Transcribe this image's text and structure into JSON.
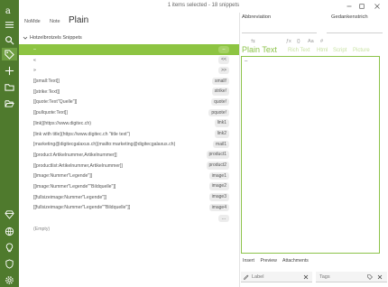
{
  "window": {
    "title": "1 items selected - 18 snippets"
  },
  "sidebar": {
    "icons": [
      "menu-icon",
      "search-icon",
      "tag-icon",
      "add-icon",
      "folder-icon",
      "open-folder-icon",
      "diamond-icon",
      "globe-icon",
      "lightbulb-icon",
      "shield-icon",
      "settings-icon"
    ]
  },
  "list": {
    "tabs": [
      "NoMde",
      "Note",
      "Plain"
    ],
    "group": "Hotzelbrotzels Snippets",
    "rows": [
      {
        "text": "–",
        "abbr": "--"
      },
      {
        "text": "«",
        "abbr": "<<"
      },
      {
        "text": "»",
        "abbr": ">>"
      },
      {
        "text": "[[small:Text]]",
        "abbr": "small!"
      },
      {
        "text": "[[strike:Text]]",
        "abbr": "strike!"
      },
      {
        "text": "[[quote:Text\"Quelle\"]]",
        "abbr": "quote!"
      },
      {
        "text": "[[pullquote:Text]]",
        "abbr": "pquote!"
      },
      {
        "text": "[link](https://www.digitec.ch)",
        "abbr": "link1"
      },
      {
        "text": "[link with title](https://www.digitec.ch \"title text\")",
        "abbr": "link2"
      },
      {
        "text": "[marketing@digitecgalaxus.ch](mailto:marketing@digitecgalaxus.ch)",
        "abbr": "mail1"
      },
      {
        "text": "[[product:Artikelnummer,Artikelnummer]]",
        "abbr": "product1"
      },
      {
        "text": "[[productlist:Artikelnummer,Artikelnummer]]",
        "abbr": "product2"
      },
      {
        "text": "[[image:Nummer\"Legende\"]]",
        "abbr": "image1"
      },
      {
        "text": "[[image:Nummer\"Legende\"\"Bildquelle\"]]",
        "abbr": "image2"
      },
      {
        "text": "[[fullsizeimage:Nummer\"Legende\"]]",
        "abbr": "image3"
      },
      {
        "text": "[[fullsizeimage:Nummer\"Legende\"\"Bildquelle\"]]",
        "abbr": "image4"
      },
      {
        "text": "",
        "abbr": "..."
      },
      {
        "text": "(Empty)",
        "abbr": ""
      }
    ]
  },
  "detail": {
    "abbreviation_label": "Abbreviation",
    "dash_label": "Gedankenstrich",
    "tools": [
      "⇆",
      "ƒx",
      "{}",
      "Aa",
      "#"
    ],
    "formats": [
      "Plain Text",
      "Rich Text",
      "Html",
      "Script",
      "Picture"
    ],
    "editor_content": "–",
    "bottom_tabs": [
      "Insert",
      "Preview",
      "Attachments"
    ],
    "label_placeholder": "Label",
    "tags_placeholder": "Tags"
  },
  "colors": {
    "sidebar": "#4f7a2d",
    "accent": "#8cc34a",
    "selected_row": "#8dc442"
  }
}
